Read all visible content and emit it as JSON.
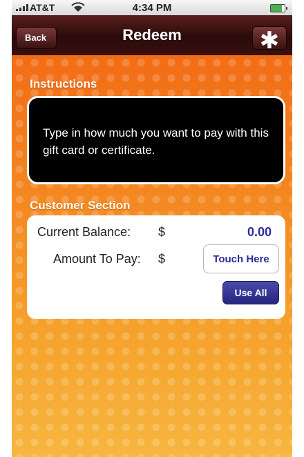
{
  "status_bar": {
    "carrier": "AT&T",
    "time": "4:34 PM",
    "wifi_icon": "wifi-icon",
    "battery_icon": "battery-icon"
  },
  "nav_bar": {
    "title": "Redeem",
    "back_label": "Back",
    "action_icon": "asterisk-icon",
    "action_glyph": "✱"
  },
  "instructions": {
    "header": "Instructions",
    "text": "Type in how much you want to pay with this gift card or certificate."
  },
  "customer_section": {
    "header": "Customer Section",
    "current_balance_label": "Current Balance:",
    "current_balance_currency": "$",
    "current_balance_value": "0.00",
    "amount_to_pay_label": "Amount To Pay:",
    "amount_to_pay_currency": "$",
    "amount_to_pay_placeholder": "Touch Here",
    "use_all_label": "Use All"
  },
  "colors": {
    "accent_blue": "#2d2a9a",
    "nav_bar": "#3a1010",
    "background": "#f28a1c"
  }
}
